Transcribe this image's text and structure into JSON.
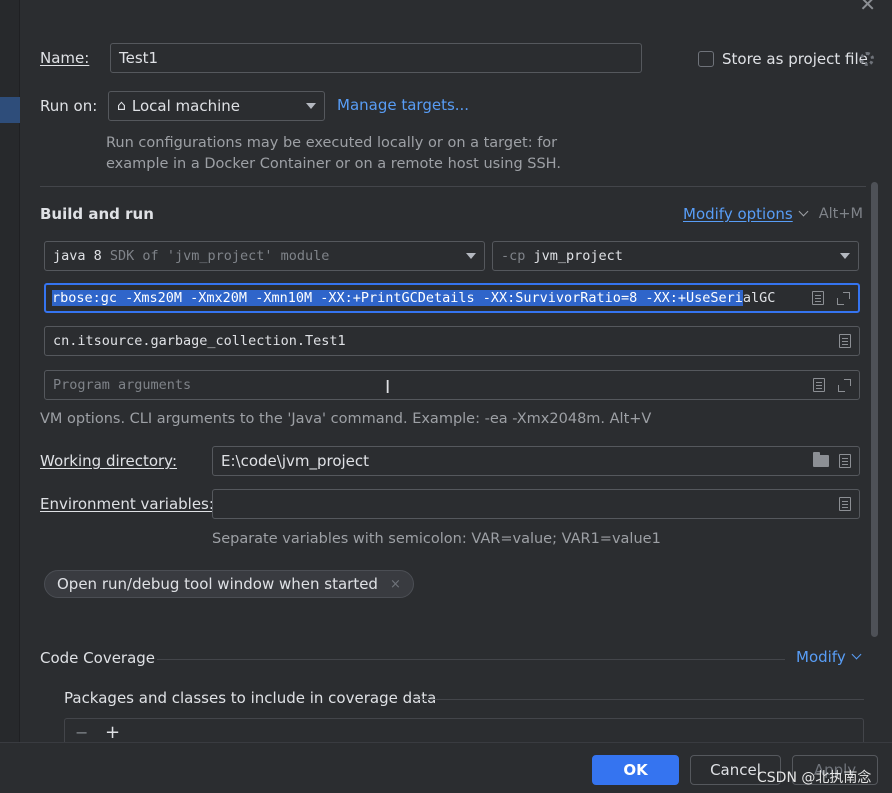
{
  "dialog": {
    "name_label": "Name:",
    "name_value": "Test1",
    "store_label": "Store as project file",
    "run_on_label": "Run on:",
    "run_on_value": "Local machine",
    "manage_targets": "Manage targets...",
    "run_hint_line1": "Run configurations may be executed locally or on a target: for",
    "run_hint_line2": "example in a Docker Container or on a remote host using SSH."
  },
  "build": {
    "title": "Build and run",
    "modify_options": "Modify options",
    "modify_shortcut": "Alt+M",
    "jdk_name": "java 8",
    "jdk_hint": "SDK of 'jvm_project' module",
    "cp_prefix": "-cp",
    "cp_value": "jvm_project",
    "vm_selected": "rbose:gc -Xms20M -Xmx20M -Xmn10M -XX:+PrintGCDetails -XX:SurvivorRatio=8 -XX:+UseSeri",
    "vm_rest": "alGC",
    "main_class": "cn.itsource.garbage_collection.Test1",
    "program_args_placeholder": "Program arguments",
    "vm_hint": "VM options. CLI arguments to the 'Java' command. Example: -ea -Xmx2048m. Alt+V",
    "working_dir_label": "Working directory:",
    "working_dir_value": "E:\\code\\jvm_project",
    "env_label": "Environment variables:",
    "env_value": "",
    "env_hint": "Separate variables with semicolon: VAR=value; VAR1=value1",
    "chip_label": "Open run/debug tool window when started",
    "chip_close": "×"
  },
  "coverage": {
    "title": "Code Coverage",
    "modify": "Modify",
    "packages_label": "Packages and classes to include in coverage data",
    "minus": "−",
    "plus": "+"
  },
  "footer": {
    "ok": "OK",
    "cancel": "Cancel",
    "apply": "Apply"
  },
  "watermark": "CSDN @北执南念"
}
